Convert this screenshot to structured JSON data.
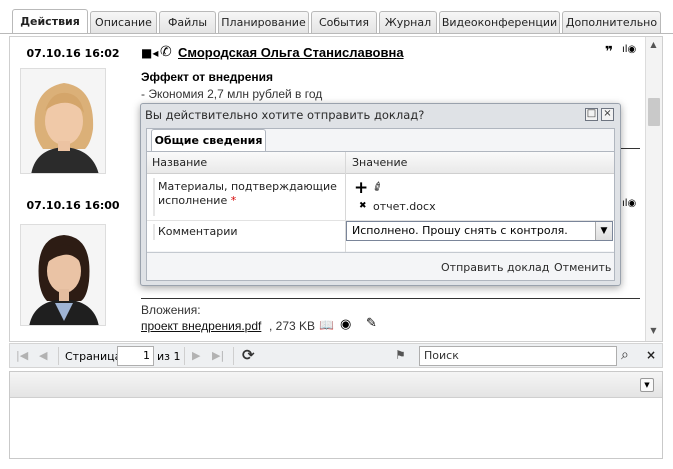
{
  "tabs": [
    "Действия",
    "Описание",
    "Файлы",
    "Планирование",
    "События",
    "Журнал",
    "Видеоконференции",
    "Дополнительно"
  ],
  "active_tab": "Действия",
  "entries": [
    {
      "date": "07.10.16 16:02",
      "person": "Смородская Ольга Станиславовна",
      "heading": "Эффект от внедрения",
      "text": "- Экономия 2,7 млн рублей в год"
    },
    {
      "date": "07.10.16 16:00",
      "attachments_label": "Вложения:",
      "file_name": "проект внедрения.pdf",
      "file_size": ", 273 KB"
    }
  ],
  "dialog": {
    "title": "Вы действительно хотите отправить доклад?",
    "tab": "Общие сведения",
    "col_name": "Название",
    "col_value": "Значение",
    "row1_label": "Материалы, подтверждающие исполнение",
    "row1_required": "*",
    "row1_file": "отчет.docx",
    "row2_label": "Комментарии",
    "row2_value": "Исполнено. Прошу снять с контроля.",
    "send_button": "Отправить доклад",
    "cancel_button": "Отменить"
  },
  "pager": {
    "page_label": "Страница",
    "page_value": "1",
    "page_of": "из 1",
    "search_placeholder": "Поиск"
  },
  "colors": {
    "accent": "#1a1a1a",
    "required": "#d40000"
  }
}
